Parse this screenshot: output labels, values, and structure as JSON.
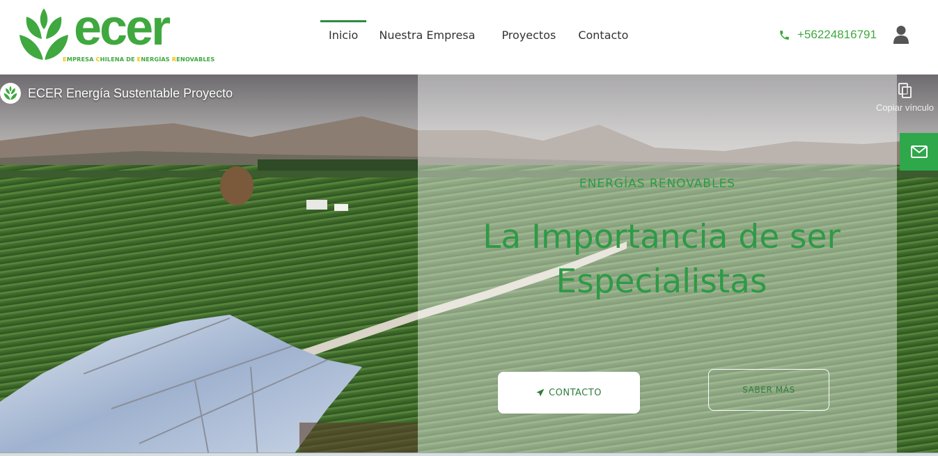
{
  "brand": {
    "name": "ecer",
    "tagline_parts": [
      {
        "t": "E",
        "y": true
      },
      {
        "t": "MPRESA ",
        "y": false
      },
      {
        "t": "C",
        "y": true
      },
      {
        "t": "HILENA DE ",
        "y": false
      },
      {
        "t": "E",
        "y": true
      },
      {
        "t": "NERGÍAS ",
        "y": false
      },
      {
        "t": "R",
        "y": true
      },
      {
        "t": "ENOVABLES",
        "y": false
      }
    ],
    "primary_color": "#3fa83f",
    "accent_color": "#f2c200"
  },
  "nav": {
    "items": [
      {
        "label": "Inicio",
        "active": true
      },
      {
        "label": "Nuestra Empresa",
        "active": false
      },
      {
        "label": "Proyectos",
        "active": false
      },
      {
        "label": "Contacto",
        "active": false
      }
    ]
  },
  "contact": {
    "phone": "+56224816791",
    "phone_icon": "phone-icon",
    "user_icon": "user-icon"
  },
  "video": {
    "title": "ECER Energía Sustentable Proyecto",
    "copy_link_label": "Copiar vínculo"
  },
  "hero": {
    "kicker": "ENERGÍAS RENOVABLES",
    "headline_line1": "La Importancia de ser",
    "headline_line2": "Especialistas",
    "contact_button": "CONTACTO",
    "more_button": "SABER MÁS"
  },
  "colors": {
    "hero_green": "#2e9a46",
    "mail_button": "#2ea84a"
  }
}
